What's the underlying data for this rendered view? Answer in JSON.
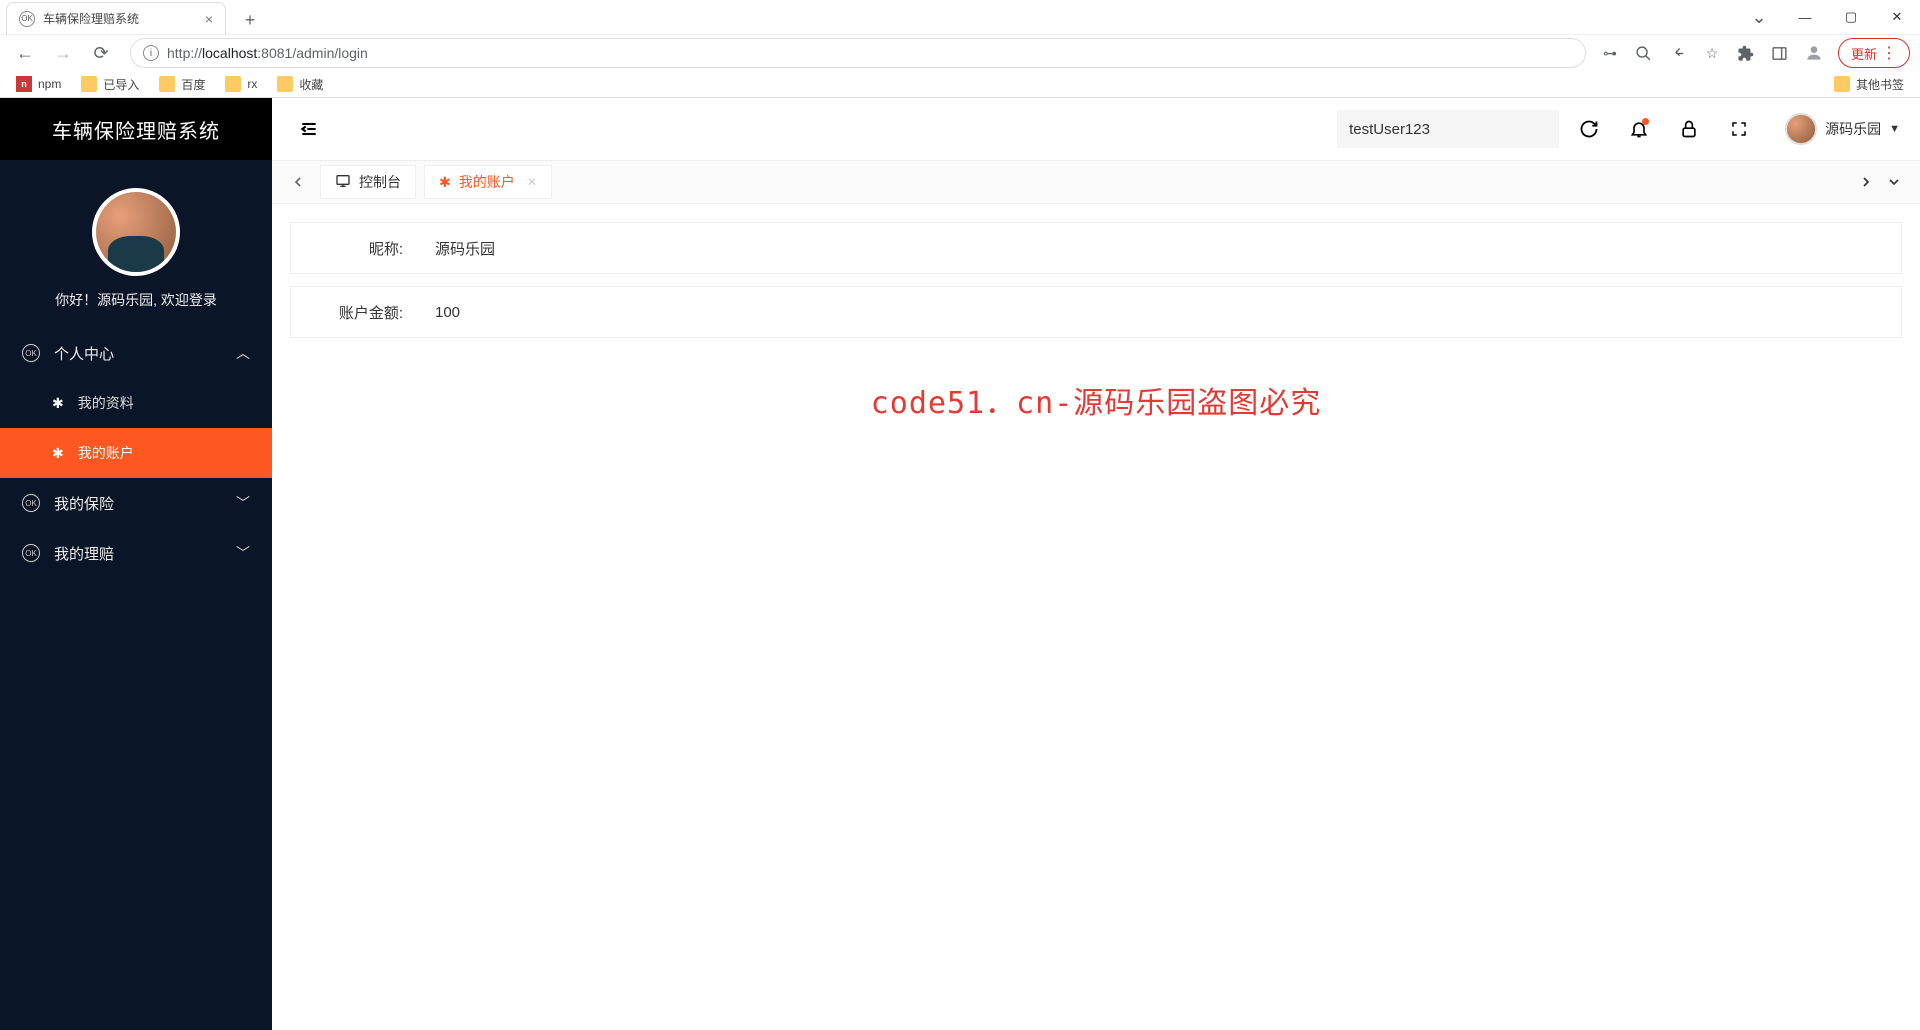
{
  "browser": {
    "tab_title": "车辆保险理赔系统",
    "url_http": "http://",
    "url_host": "localhost",
    "url_port": ":8081",
    "url_path": "/admin/login",
    "update_button": "更新",
    "bookmarks": [
      "npm",
      "已导入",
      "百度",
      "rx",
      "收藏"
    ],
    "other_bookmarks": "其他书签"
  },
  "app": {
    "brand": "车辆保险理赔系统",
    "greeting": "你好！源码乐园, 欢迎登录",
    "search_value": "testUser123",
    "username": "源码乐园"
  },
  "sidebar": {
    "items": [
      {
        "label": "个人中心",
        "expanded": true
      },
      {
        "label": "我的保险",
        "expanded": false
      },
      {
        "label": "我的理赔",
        "expanded": false
      }
    ],
    "sub_items": [
      {
        "label": "我的资料",
        "active": false
      },
      {
        "label": "我的账户",
        "active": true
      }
    ]
  },
  "tabs": {
    "items": [
      {
        "icon": "console",
        "label": "控制台",
        "active": false,
        "closable": false
      },
      {
        "icon": "star",
        "label": "我的账户",
        "active": true,
        "closable": true
      }
    ]
  },
  "account": {
    "rows": [
      {
        "label": "昵称:",
        "value": "源码乐园"
      },
      {
        "label": "账户金额:",
        "value": "100"
      }
    ]
  },
  "watermark": "code51．cn-源码乐园盗图必究"
}
